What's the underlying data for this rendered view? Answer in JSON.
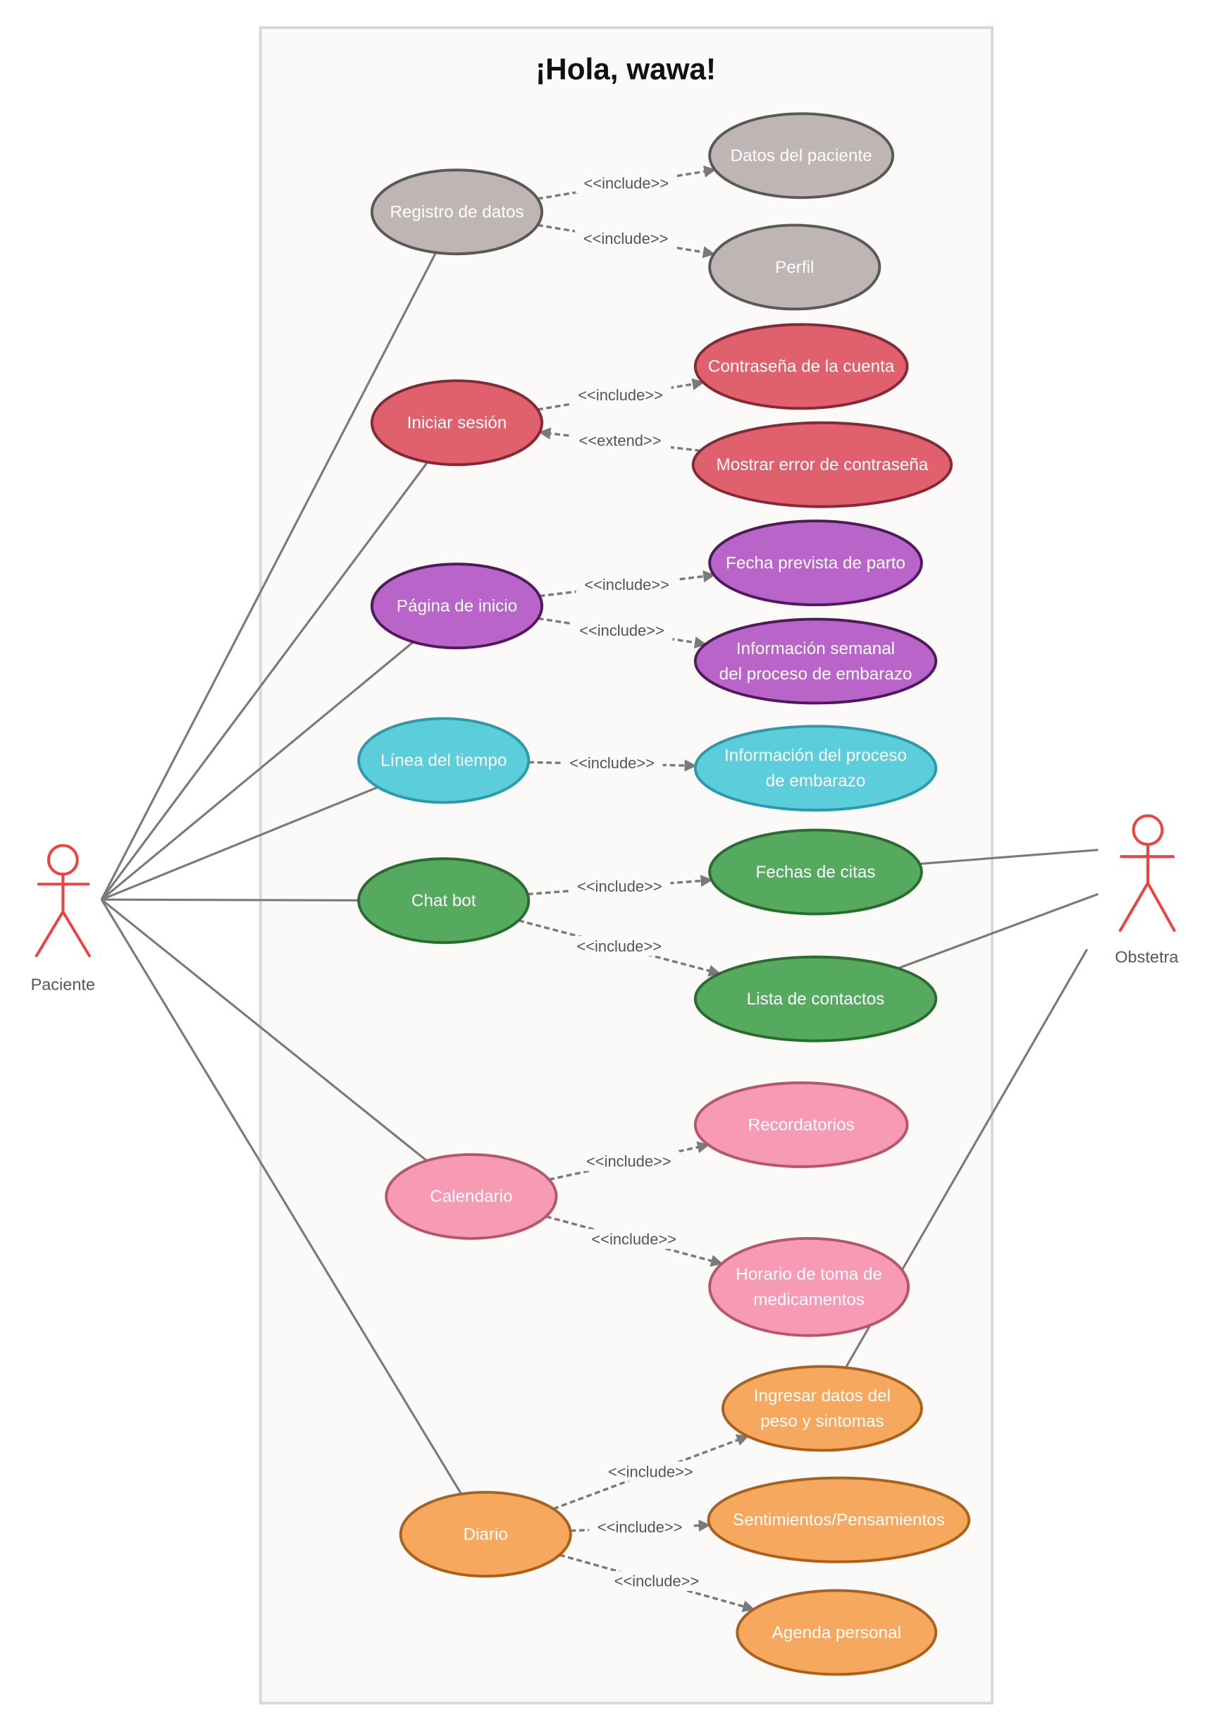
{
  "diagram": {
    "title": "¡Hola, wawa!",
    "type": "UML use case diagram",
    "actors": [
      {
        "id": "paciente",
        "label": "Paciente"
      },
      {
        "id": "obstetra",
        "label": "Obstetra"
      }
    ],
    "colors": {
      "gray": {
        "fill": "#bfb5b4",
        "stroke": "#595959"
      },
      "red": {
        "fill": "#e0616d",
        "stroke": "#822b36"
      },
      "purple": {
        "fill": "#b964c8",
        "stroke": "#4e1a5c"
      },
      "cyan": {
        "fill": "#5ccdda",
        "stroke": "#2d9aab"
      },
      "green": {
        "fill": "#55aa60",
        "stroke": "#2c6b30"
      },
      "pink": {
        "fill": "#f79ab4",
        "stroke": "#b5566f"
      },
      "orange": {
        "fill": "#f5a85e",
        "stroke": "#a8621e"
      },
      "actor": "#f04040",
      "line": "#7a7a7a"
    },
    "use_cases": [
      {
        "id": "registro",
        "lines": [
          "Registro de datos"
        ],
        "color": "gray"
      },
      {
        "id": "datos_paciente",
        "lines": [
          "Datos del paciente"
        ],
        "color": "gray"
      },
      {
        "id": "perfil",
        "lines": [
          "Perfil"
        ],
        "color": "gray"
      },
      {
        "id": "iniciar",
        "lines": [
          "Iniciar sesión"
        ],
        "color": "red"
      },
      {
        "id": "contrasena",
        "lines": [
          "Contraseña de la cuenta"
        ],
        "color": "red"
      },
      {
        "id": "error",
        "lines": [
          "Mostrar error de contraseña"
        ],
        "color": "red"
      },
      {
        "id": "pagina",
        "lines": [
          "Página de inicio"
        ],
        "color": "purple"
      },
      {
        "id": "fecha_parto",
        "lines": [
          "Fecha prevista de parto"
        ],
        "color": "purple"
      },
      {
        "id": "info_semanal",
        "lines": [
          "Información semanal",
          "del proceso de embarazo"
        ],
        "color": "purple"
      },
      {
        "id": "linea",
        "lines": [
          "Línea del tiempo"
        ],
        "color": "cyan"
      },
      {
        "id": "info_proceso",
        "lines": [
          "Información del proceso",
          "de embarazo"
        ],
        "color": "cyan"
      },
      {
        "id": "chatbot",
        "lines": [
          "Chat bot"
        ],
        "color": "green"
      },
      {
        "id": "fechas_citas",
        "lines": [
          "Fechas de citas"
        ],
        "color": "green"
      },
      {
        "id": "contactos",
        "lines": [
          "Lista de contactos"
        ],
        "color": "green"
      },
      {
        "id": "calendario",
        "lines": [
          "Calendario"
        ],
        "color": "pink"
      },
      {
        "id": "recordatorios",
        "lines": [
          "Recordatorios"
        ],
        "color": "pink"
      },
      {
        "id": "horario",
        "lines": [
          "Horario  de  toma de",
          "medicamentos"
        ],
        "color": "pink"
      },
      {
        "id": "diario",
        "lines": [
          "Diario"
        ],
        "color": "orange"
      },
      {
        "id": "ingresar",
        "lines": [
          "Ingresar datos del",
          "peso y  sintomas"
        ],
        "color": "orange"
      },
      {
        "id": "sentimientos",
        "lines": [
          "Sentimientos/Pensamientos"
        ],
        "color": "orange"
      },
      {
        "id": "agenda",
        "lines": [
          "Agenda personal"
        ],
        "color": "orange"
      }
    ],
    "associations": [
      {
        "actor": "paciente",
        "use_case": "registro"
      },
      {
        "actor": "paciente",
        "use_case": "iniciar"
      },
      {
        "actor": "paciente",
        "use_case": "pagina"
      },
      {
        "actor": "paciente",
        "use_case": "linea"
      },
      {
        "actor": "paciente",
        "use_case": "chatbot"
      },
      {
        "actor": "paciente",
        "use_case": "calendario"
      },
      {
        "actor": "paciente",
        "use_case": "diario"
      },
      {
        "actor": "obstetra",
        "use_case": "fechas_citas"
      },
      {
        "actor": "obstetra",
        "use_case": "contactos"
      },
      {
        "actor": "obstetra",
        "use_case": "ingresar"
      }
    ],
    "relations": [
      {
        "from": "registro",
        "to": "datos_paciente",
        "label": "<<include>>"
      },
      {
        "from": "registro",
        "to": "perfil",
        "label": "<<include>>"
      },
      {
        "from": "iniciar",
        "to": "contrasena",
        "label": "<<include>>"
      },
      {
        "from": "error",
        "to": "iniciar",
        "label": "<<extend>>"
      },
      {
        "from": "pagina",
        "to": "fecha_parto",
        "label": "<<include>>"
      },
      {
        "from": "pagina",
        "to": "info_semanal",
        "label": "<<include>>"
      },
      {
        "from": "linea",
        "to": "info_proceso",
        "label": "<<include>>"
      },
      {
        "from": "chatbot",
        "to": "fechas_citas",
        "label": "<<include>>"
      },
      {
        "from": "chatbot",
        "to": "contactos",
        "label": "<<include>>"
      },
      {
        "from": "calendario",
        "to": "recordatorios",
        "label": "<<include>>"
      },
      {
        "from": "calendario",
        "to": "horario",
        "label": "<<include>>"
      },
      {
        "from": "diario",
        "to": "ingresar",
        "label": "<<include>>"
      },
      {
        "from": "diario",
        "to": "sentimientos",
        "label": "<<include>>"
      },
      {
        "from": "diario",
        "to": "agenda",
        "label": "<<include>>"
      }
    ]
  }
}
